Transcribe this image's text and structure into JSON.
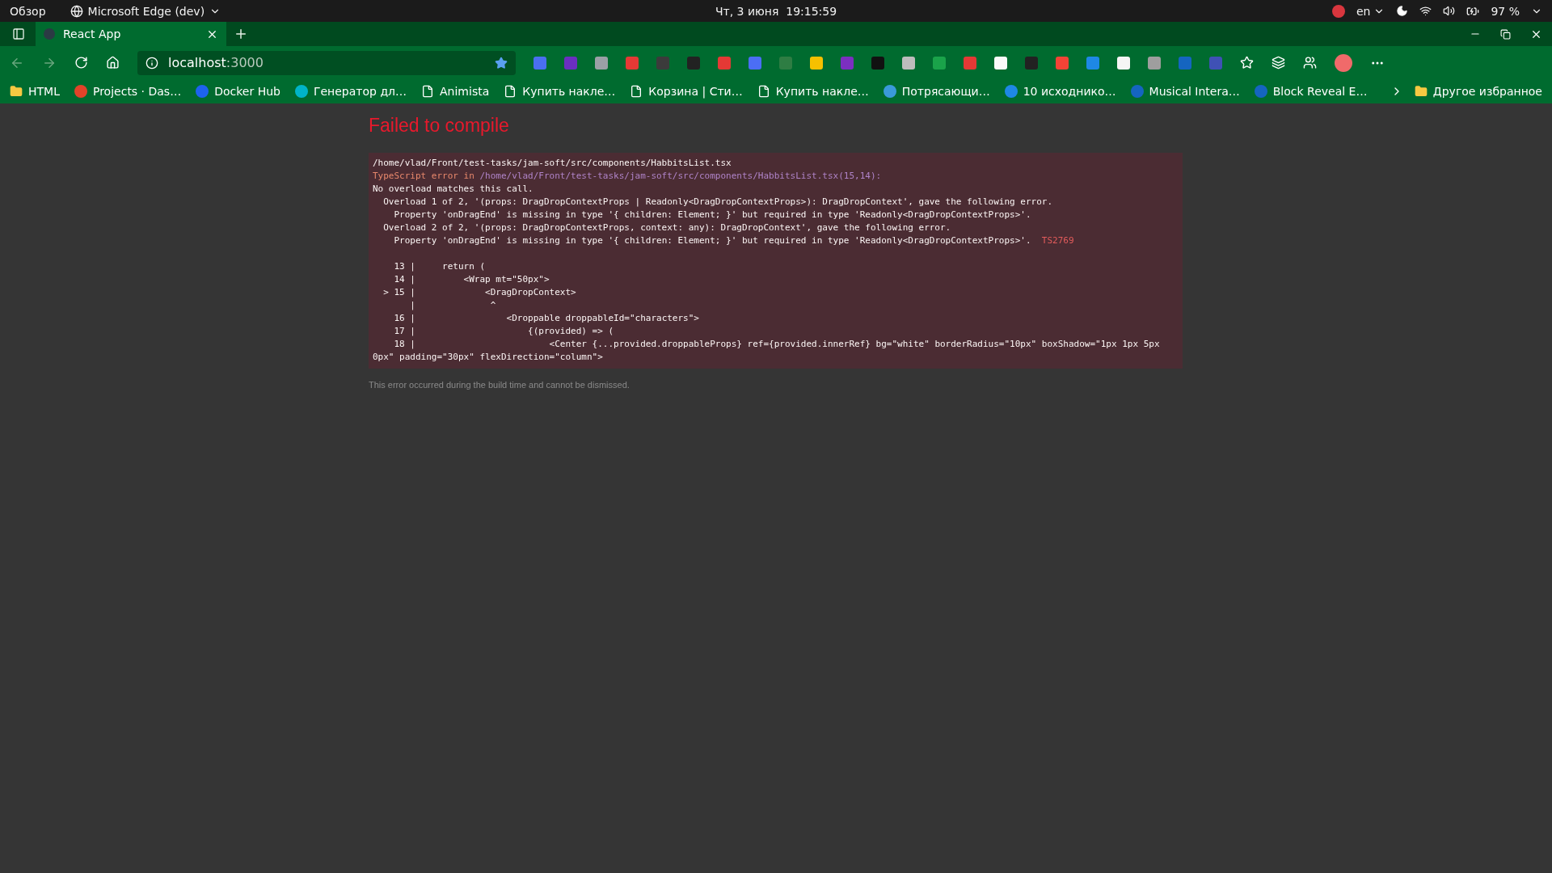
{
  "top_bar": {
    "activities": "Обзор",
    "app_menu": "Microsoft Edge (dev)",
    "clock": "Чт, 3 июня  19:15:59",
    "keyboard_layout": "en",
    "battery": "97 %"
  },
  "tabs": [
    {
      "title": "React App",
      "selected": true
    }
  ],
  "address_bar": {
    "host": "localhost",
    "port": ":3000"
  },
  "bookmarks": [
    {
      "kind": "folder",
      "label": "HTML"
    },
    {
      "kind": "site",
      "color": "#e24329",
      "label": "Projects · Das…"
    },
    {
      "kind": "site",
      "color": "#1d63ed",
      "label": "Docker Hub"
    },
    {
      "kind": "site",
      "color": "#00b4c8",
      "label": "Генератор дл…"
    },
    {
      "kind": "page",
      "label": "Animista"
    },
    {
      "kind": "page",
      "label": "Купить накле…"
    },
    {
      "kind": "page",
      "label": "Корзина | Сти…"
    },
    {
      "kind": "page",
      "label": "Купить накле…"
    },
    {
      "kind": "site",
      "color": "#3a9ad9",
      "label": "Потрясающи…"
    },
    {
      "kind": "site",
      "color": "#1e88e5",
      "label": "10 исходнико…"
    },
    {
      "kind": "site",
      "color": "#1565c0",
      "label": "Musical Intera…"
    },
    {
      "kind": "site",
      "color": "#1565c0",
      "label": "Block Reveal E…"
    }
  ],
  "other_bookmarks": "Другое избранное",
  "error_overlay": {
    "title": "Failed to compile",
    "lines": [
      [
        {
          "kind": "plain",
          "text": "/home/vlad/Front/test-tasks/jam-soft/src/components/HabbitsList.tsx"
        }
      ],
      [
        {
          "kind": "label",
          "text": "TypeScript error in "
        },
        {
          "kind": "path",
          "text": "/home/vlad/Front/test-tasks/jam-soft/src/components/HabbitsList.tsx(15,14):"
        }
      ],
      [
        {
          "kind": "plain",
          "text": "No overload matches this call."
        }
      ],
      [
        {
          "kind": "plain",
          "text": "  Overload 1 of 2, '(props: DragDropContextProps | Readonly<DragDropContextProps>): DragDropContext', gave the following error."
        }
      ],
      [
        {
          "kind": "plain",
          "text": "    Property 'onDragEnd' is missing in type '{ children: Element; }' but required in type 'Readonly<DragDropContextProps>'."
        }
      ],
      [
        {
          "kind": "plain",
          "text": "  Overload 2 of 2, '(props: DragDropContextProps, context: any): DragDropContext', gave the following error."
        }
      ],
      [
        {
          "kind": "plain",
          "text": "    Property 'onDragEnd' is missing in type '{ children: Element; }' but required in type 'Readonly<DragDropContextProps>'.  "
        },
        {
          "kind": "code",
          "text": "TS2769"
        }
      ]
    ],
    "code_frame": [
      "    13 |     return (",
      "    14 |         <Wrap mt=\"50px\">",
      "  > 15 |             <DragDropContext>",
      "       |              ^",
      "    16 |                 <Droppable droppableId=\"characters\">",
      "    17 |                     {(provided) => (",
      "    18 |                         <Center {...provided.droppableProps} ref={provided.innerRef} bg=\"white\" borderRadius=\"10px\" boxShadow=\"1px 1px 5px 0px\" padding=\"30px\" flexDirection=\"column\">"
    ],
    "footer": "This error occurred during the build time and cannot be dismissed."
  }
}
